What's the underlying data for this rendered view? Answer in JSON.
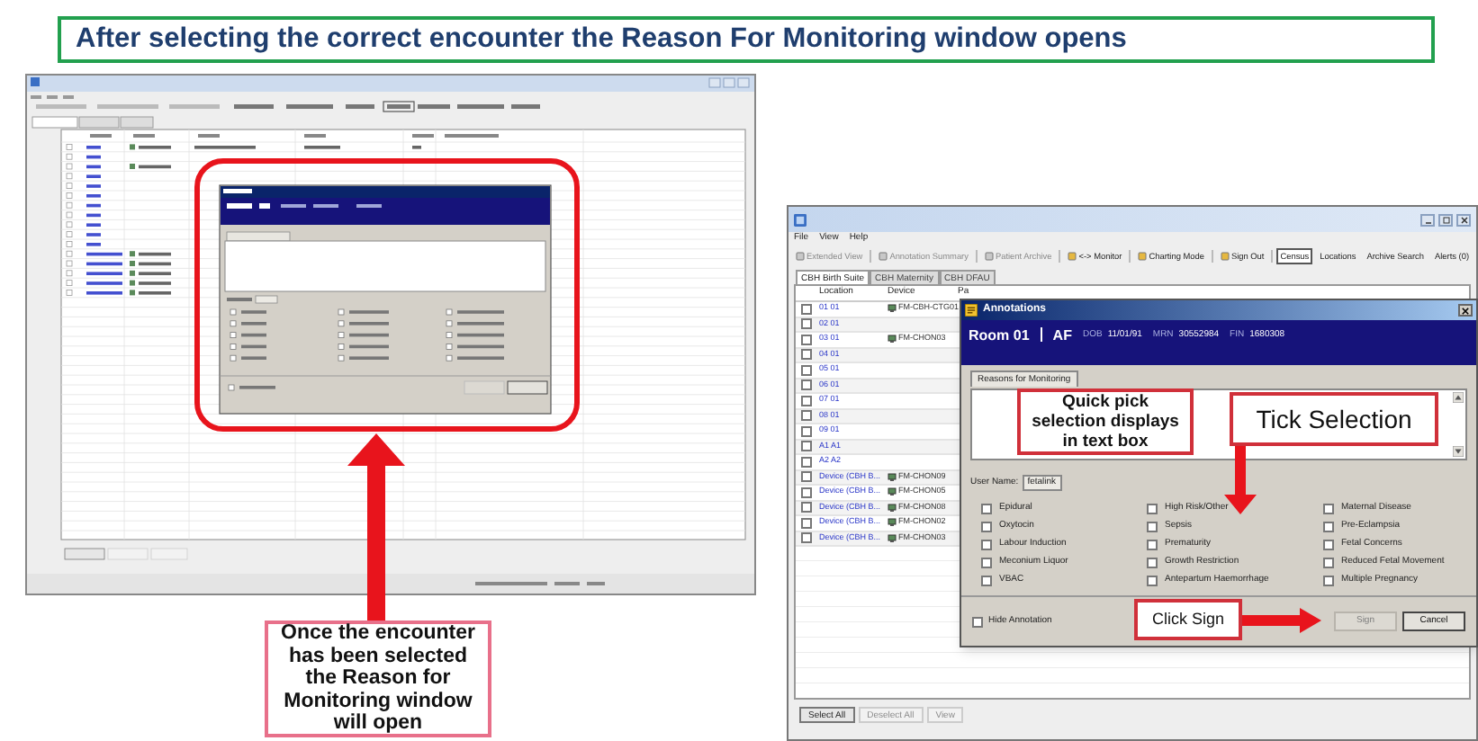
{
  "title": "After selecting the correct encounter the Reason For Monitoring window opens",
  "screenshot": {
    "menu": [
      "File",
      "View",
      "Help"
    ],
    "toolbar": [
      {
        "kind": "tool",
        "label": "Extended View",
        "disabled": true,
        "selected": false
      },
      {
        "kind": "tool",
        "label": "Annotation Summary",
        "disabled": true,
        "selected": false
      },
      {
        "kind": "tool",
        "label": "Patient Archive",
        "disabled": true,
        "selected": false
      },
      {
        "kind": "tool",
        "label": "<-> Monitor",
        "disabled": false,
        "selected": false
      },
      {
        "kind": "tool",
        "label": "Charting Mode",
        "disabled": false,
        "selected": false
      },
      {
        "kind": "tool",
        "label": "Sign Out",
        "disabled": false,
        "selected": false
      },
      {
        "kind": "link",
        "label": "Census",
        "disabled": false,
        "selected": true
      },
      {
        "kind": "link",
        "label": "Locations",
        "disabled": false,
        "selected": false
      },
      {
        "kind": "link",
        "label": "Archive Search",
        "disabled": false,
        "selected": false
      },
      {
        "kind": "link",
        "label": "Alerts (0)",
        "disabled": false,
        "selected": false
      }
    ],
    "tabs": [
      {
        "label": "CBH Birth Suite",
        "selected": true
      },
      {
        "label": "CBH Maternity",
        "selected": false
      },
      {
        "label": "CBH DFAU",
        "selected": false
      }
    ],
    "columns": [
      "Location",
      "Device",
      "Pa"
    ],
    "rows": [
      {
        "checked": false,
        "location": "01 01",
        "device": "FM-CBH-CTG01"
      },
      {
        "checked": false,
        "location": "02 01"
      },
      {
        "checked": false,
        "location": "03 01",
        "device": "FM-CHON03"
      },
      {
        "checked": false,
        "location": "04 01"
      },
      {
        "checked": false,
        "location": "05 01"
      },
      {
        "checked": false,
        "location": "06 01"
      },
      {
        "checked": false,
        "location": "07 01"
      },
      {
        "checked": false,
        "location": "08 01"
      },
      {
        "checked": false,
        "location": "09 01"
      },
      {
        "checked": false,
        "location": "A1 A1"
      },
      {
        "checked": false,
        "location": "A2 A2"
      },
      {
        "checked": false,
        "location": "Device (CBH B...",
        "device": "FM-CHON09"
      },
      {
        "checked": false,
        "location": "Device (CBH B...",
        "device": "FM-CHON05"
      },
      {
        "checked": false,
        "location": "Device (CBH B...",
        "device": "FM-CHON08"
      },
      {
        "checked": false,
        "location": "Device (CBH B...",
        "device": "FM-CHON02"
      },
      {
        "checked": false,
        "location": "Device (CBH B...",
        "device": "FM-CHON03"
      }
    ],
    "buttons": [
      {
        "label": "Select All",
        "disabled": false
      },
      {
        "label": "Deselect All",
        "disabled": true
      },
      {
        "label": "View",
        "disabled": true
      }
    ],
    "dialog": {
      "title": "Annotations",
      "room": "Room 01",
      "patient": "AF",
      "fields": [
        {
          "label": "DOB",
          "value": "11/01/91"
        },
        {
          "label": "MRN",
          "value": "30552984"
        },
        {
          "label": "FIN",
          "value": "1680308"
        }
      ],
      "tab": {
        "label": "Reasons for Monitoring",
        "selected": true
      },
      "user_label": "User Name:",
      "user_name": "fetalink",
      "options": [
        {
          "label": "Epidural",
          "checked": false
        },
        {
          "label": "High Risk/Other",
          "checked": false
        },
        {
          "label": "Maternal Disease",
          "checked": false
        },
        {
          "label": "Oxytocin",
          "checked": false
        },
        {
          "label": "Sepsis",
          "checked": false
        },
        {
          "label": "Pre-Eclampsia",
          "checked": false
        },
        {
          "label": "Labour Induction",
          "checked": false
        },
        {
          "label": "Prematurity",
          "checked": false
        },
        {
          "label": "Fetal Concerns",
          "checked": false
        },
        {
          "label": "Meconium Liquor",
          "checked": false
        },
        {
          "label": "Growth Restriction",
          "checked": false
        },
        {
          "label": "Reduced Fetal Movement",
          "checked": false
        },
        {
          "label": "VBAC",
          "checked": false
        },
        {
          "label": "Antepartum Haemorrhage",
          "checked": false
        },
        {
          "label": "Multiple Pregnancy",
          "checked": false
        }
      ],
      "hide": {
        "label": "Hide Annotation",
        "checked": false
      },
      "buttons": [
        {
          "label": "Sign",
          "disabled": true
        },
        {
          "label": "Cancel",
          "disabled": false
        }
      ]
    }
  },
  "callouts": [
    {
      "text": "Once the encounter has been selected the Reason for Monitoring window will open"
    },
    {
      "text": "Quick pick selection displays in text box"
    },
    {
      "text": "Tick Selection"
    },
    {
      "text": "Click Sign"
    }
  ]
}
